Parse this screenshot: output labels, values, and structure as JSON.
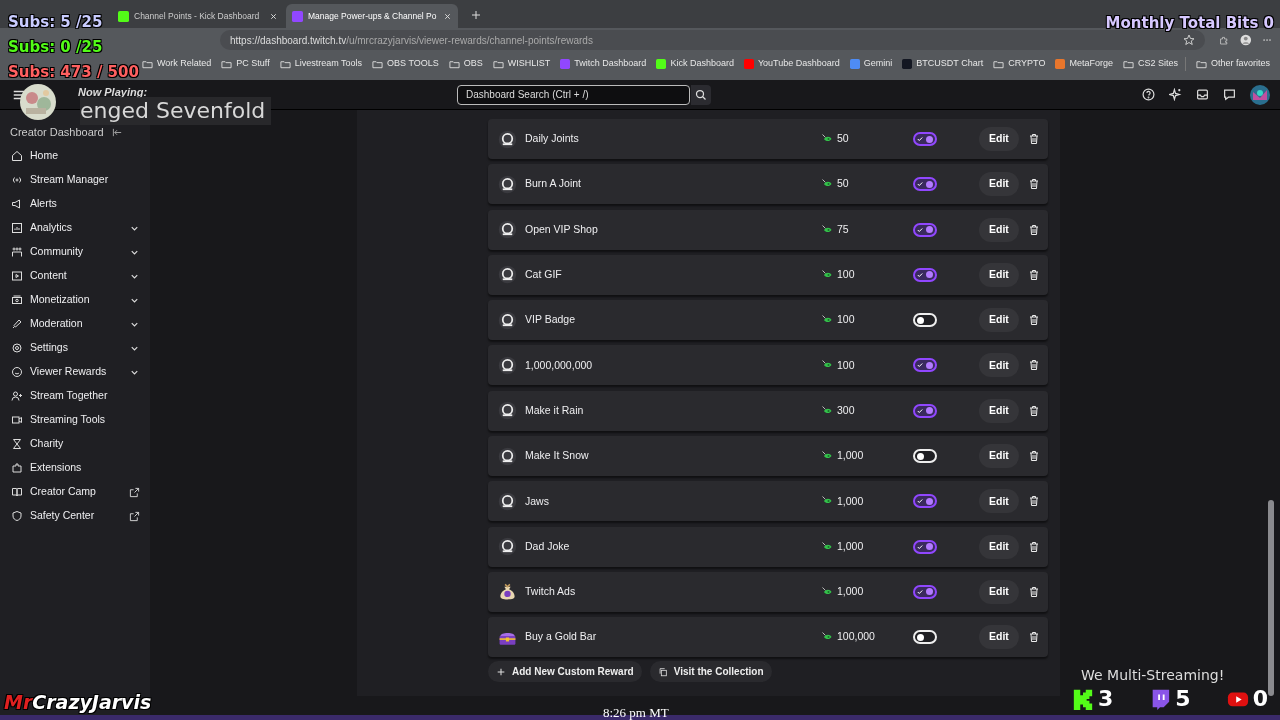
{
  "browser": {
    "tabs": [
      {
        "title": "Channel Points - Kick Dashboard",
        "selected": false,
        "color": "#53fc18"
      },
      {
        "title": "Manage Power-ups & Channel Po",
        "selected": true,
        "color": "#9147ff"
      }
    ],
    "url": {
      "host": "https://dashboard.twitch.tv",
      "path": "/u/mrcrazyjarvis/viewer-rewards/channel-points/rewards"
    },
    "bookmarks": [
      {
        "label": "Work Related",
        "kind": "folder"
      },
      {
        "label": "PC Stuff",
        "kind": "folder"
      },
      {
        "label": "Livestream Tools",
        "kind": "folder"
      },
      {
        "label": "OBS TOOLS",
        "kind": "folder"
      },
      {
        "label": "OBS",
        "kind": "folder"
      },
      {
        "label": "WISHLIST",
        "kind": "folder"
      },
      {
        "label": "Twitch Dashboard",
        "kind": "site",
        "color": "#9147ff"
      },
      {
        "label": "Kick Dashboard",
        "kind": "site",
        "color": "#53fc18"
      },
      {
        "label": "YouTube Dashboard",
        "kind": "site",
        "color": "#ff0000"
      },
      {
        "label": "Gemini",
        "kind": "site",
        "color": "#4e8cf5"
      },
      {
        "label": "BTCUSDT Chart",
        "kind": "site",
        "color": "#131722"
      },
      {
        "label": "CRYPTO",
        "kind": "folder"
      },
      {
        "label": "MetaForge",
        "kind": "site",
        "color": "#e8762c"
      },
      {
        "label": "CS2 Sites",
        "kind": "folder"
      }
    ],
    "other_bookmarks": "Other favorites"
  },
  "search": {
    "placeholder": "Dashboard Search (Ctrl + /)"
  },
  "sidebar": {
    "title": "Creator Dashboard",
    "items": [
      {
        "label": "Home",
        "kind": "link"
      },
      {
        "label": "Stream Manager",
        "kind": "link"
      },
      {
        "label": "Alerts",
        "kind": "link"
      },
      {
        "label": "Analytics",
        "kind": "expandable"
      },
      {
        "label": "Community",
        "kind": "expandable"
      },
      {
        "label": "Content",
        "kind": "expandable"
      },
      {
        "label": "Monetization",
        "kind": "expandable"
      },
      {
        "label": "Moderation",
        "kind": "expandable"
      },
      {
        "label": "Settings",
        "kind": "expandable"
      },
      {
        "label": "Viewer Rewards",
        "kind": "expandable"
      },
      {
        "label": "Stream Together",
        "kind": "link"
      },
      {
        "label": "Streaming Tools",
        "kind": "link"
      },
      {
        "label": "Charity",
        "kind": "link"
      },
      {
        "label": "Extensions",
        "kind": "link"
      },
      {
        "label": "Creator Camp",
        "kind": "external"
      },
      {
        "label": "Safety Center",
        "kind": "external"
      }
    ]
  },
  "rewards": [
    {
      "title": "Daily Joints",
      "cost": "50",
      "enabled": true,
      "kind": "default",
      "edit_label": "Edit"
    },
    {
      "title": "Burn A Joint",
      "cost": "50",
      "enabled": true,
      "kind": "default",
      "edit_label": "Edit"
    },
    {
      "title": "Open VIP Shop",
      "cost": "75",
      "enabled": true,
      "kind": "default",
      "edit_label": "Edit"
    },
    {
      "title": "Cat GIF",
      "cost": "100",
      "enabled": true,
      "kind": "default",
      "edit_label": "Edit"
    },
    {
      "title": "VIP Badge",
      "cost": "100",
      "enabled": false,
      "kind": "default",
      "edit_label": "Edit"
    },
    {
      "title": "1,000,000,000",
      "cost": "100",
      "enabled": true,
      "kind": "default",
      "edit_label": "Edit"
    },
    {
      "title": "Make it Rain",
      "cost": "300",
      "enabled": true,
      "kind": "default",
      "edit_label": "Edit"
    },
    {
      "title": "Make It Snow",
      "cost": "1,000",
      "enabled": false,
      "kind": "default",
      "edit_label": "Edit"
    },
    {
      "title": "Jaws",
      "cost": "1,000",
      "enabled": true,
      "kind": "default",
      "edit_label": "Edit"
    },
    {
      "title": "Dad Joke",
      "cost": "1,000",
      "enabled": true,
      "kind": "default",
      "edit_label": "Edit"
    },
    {
      "title": "Twitch Ads",
      "cost": "1,000",
      "enabled": true,
      "kind": "bag",
      "edit_label": "Edit"
    },
    {
      "title": "Buy a Gold Bar",
      "cost": "100,000",
      "enabled": false,
      "kind": "chest",
      "edit_label": "Edit"
    }
  ],
  "footer_buttons": [
    {
      "label": "Add New Custom Reward",
      "kind": "add"
    },
    {
      "label": "Visit the Collection",
      "kind": "collection"
    }
  ],
  "overlay": {
    "subs": [
      {
        "text": "Subs: 5 /25",
        "color": "#c9ccff"
      },
      {
        "text": "Subs: 0 /25",
        "color": "#53fc18"
      },
      {
        "text": "Subs: 473 / 500",
        "color": "#ff6060"
      }
    ],
    "bits": "Monthly Total Bits 0",
    "now_playing_label": "Now Playing:",
    "now_playing_track": "enged Sevenfold",
    "logo": {
      "prefix": "Mr",
      "rest": "CrazyJarvis"
    },
    "time": "8:26 pm MT",
    "multistream_label": "We Multi-Streaming!",
    "platforms": [
      {
        "kind": "kick",
        "count": "3"
      },
      {
        "kind": "twitch",
        "count": "5"
      },
      {
        "kind": "youtube",
        "count": "0"
      }
    ]
  }
}
